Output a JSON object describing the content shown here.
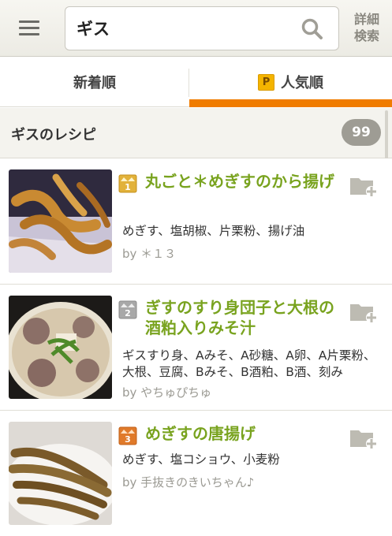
{
  "search": {
    "value": "ギス",
    "advanced_label_line1": "詳細",
    "advanced_label_line2": "検索"
  },
  "tabs": [
    {
      "label": "新着順",
      "active": false
    },
    {
      "label": "人気順",
      "badge": "P",
      "active": true
    }
  ],
  "results": {
    "title": "ギスのレシピ",
    "count": "99"
  },
  "recipes": [
    {
      "rank": "1",
      "rank_color": "#e2b23a",
      "title": "丸ごと＊めぎすのから揚げ",
      "ingredients": "めぎす、塩胡椒、片栗粉、揚げ油",
      "author": "by ＊１３",
      "image": "fried-fish-photo"
    },
    {
      "rank": "2",
      "rank_color": "#a8a8a8",
      "title": "ぎすのすり身団子と大根の酒粕入りみそ汁",
      "ingredients": "ギスすり身、Aみそ、A砂糖、A卵、A片栗粉、大根、豆腐、Bみそ、B酒粕、B酒、刻み",
      "author": "by やちゅぴちゅ",
      "image": "miso-soup-photo"
    },
    {
      "rank": "3",
      "rank_color": "#e07a2a",
      "title": "めぎすの唐揚げ",
      "ingredients": "めぎす、塩コショウ、小麦粉",
      "author": "by 手抜きのきいちゃん♪",
      "image": "karaage-photo"
    }
  ],
  "colors": {
    "accent": "#f07c00",
    "title_green": "#79a31f",
    "badge_gray": "#9e9c94"
  }
}
